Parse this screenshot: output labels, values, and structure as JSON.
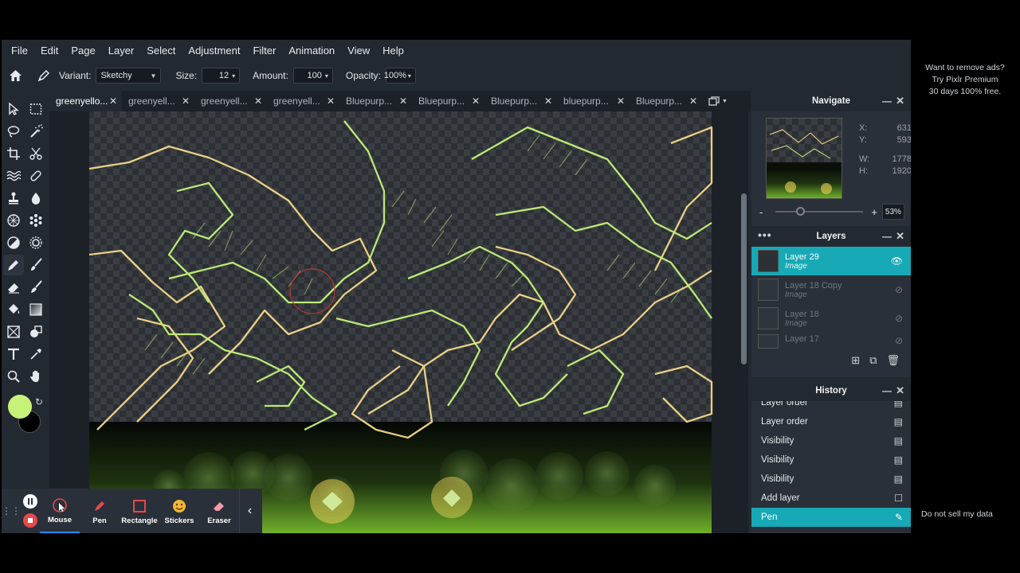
{
  "menu": [
    "File",
    "Edit",
    "Page",
    "Layer",
    "Select",
    "Adjustment",
    "Filter",
    "Animation",
    "View",
    "Help"
  ],
  "options": {
    "variant_label": "Variant:",
    "variant_value": "Sketchy",
    "size_label": "Size:",
    "size_value": "12",
    "amount_label": "Amount:",
    "amount_value": "100",
    "opacity_label": "Opacity:",
    "opacity_value": "100%"
  },
  "tabs": [
    "greenyello...",
    "greenyell...",
    "greenyell...",
    "greenyell...",
    "Bluepurp...",
    "Bluepurp...",
    "Bluepurp...",
    "bluepurp...",
    "Bluepurp..."
  ],
  "navigate": {
    "title": "Navigate",
    "x_label": "X:",
    "x_value": "631",
    "y_label": "Y:",
    "y_value": "593",
    "w_label": "W:",
    "w_value": "1778",
    "h_label": "H:",
    "h_value": "1920",
    "zoom_minus": "-",
    "zoom_plus": "+",
    "zoom_value": "53%"
  },
  "layers": {
    "title": "Layers",
    "items": [
      {
        "name": "Layer 29",
        "type": "Image"
      },
      {
        "name": "Layer 18 Copy",
        "type": "Image"
      },
      {
        "name": "Layer 18",
        "type": "Image"
      },
      {
        "name": "Layer 17",
        "type": ""
      }
    ]
  },
  "history": {
    "title": "History",
    "items": [
      "Layer order",
      "Layer order",
      "Visibility",
      "Visibility",
      "Visibility",
      "Add layer",
      "Pen"
    ]
  },
  "recorder": {
    "buttons": [
      "Mouse",
      "Pen",
      "Rectangle",
      "Stickers",
      "Eraser"
    ]
  },
  "ad": {
    "line1": "Want to remove ads?",
    "line2": "Try Pixlr Premium",
    "line3": "30 days 100% free.",
    "footer": "Do not sell my data"
  },
  "colors": {
    "accent": "#17a9b5",
    "primary_color": "#c6f27a",
    "secondary_color": "#000000",
    "stroke_yellow": "#f3d98a",
    "stroke_green": "#c6f27a"
  }
}
